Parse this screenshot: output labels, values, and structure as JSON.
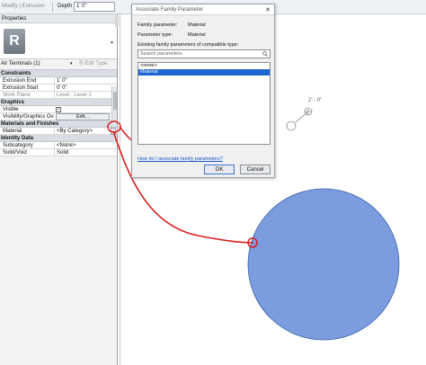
{
  "options_bar": {
    "mode_label": "Modify | Extrusion",
    "depth_label": "Depth",
    "depth_value": "1'  0\""
  },
  "properties": {
    "title": "Properties",
    "type_selector": "Air Terminals (1)",
    "edit_type_label": "Edit Type",
    "sections": {
      "constraints": "Constraints",
      "graphics": "Graphics",
      "materials": "Materials and Finishes",
      "identity": "Identity Data"
    },
    "rows": {
      "extrusion_end": {
        "label": "Extrusion End",
        "value": "1'  0\""
      },
      "extrusion_start": {
        "label": "Extrusion Start",
        "value": "0'  0\""
      },
      "work_plane": {
        "label": "Work Plane",
        "value": "Level : Level 1"
      },
      "visible": {
        "label": "Visible",
        "value": "✓"
      },
      "vis_override": {
        "label": "Visibility/Graphics Ov...",
        "value": "Edit..."
      },
      "material": {
        "label": "Material",
        "value": "<By Category>"
      },
      "subcategory": {
        "label": "Subcategory",
        "value": "<None>"
      },
      "solid_void": {
        "label": "Solid/Void",
        "value": "Solid"
      }
    }
  },
  "dialog": {
    "title": "Associate Family Parameter",
    "family_parameter_label": "Family parameter:",
    "family_parameter_value": "Material",
    "parameter_type_label": "Parameter type:",
    "parameter_type_value": "Material",
    "existing_label": "Existing family parameters of compatible type:",
    "search_placeholder": "Search parameters",
    "list_items": [
      "<none>",
      "Material"
    ],
    "selected_index": 1,
    "help_link": "How do I associate family parameters?",
    "ok_label": "OK",
    "cancel_label": "Cancel"
  },
  "canvas": {
    "dimension_text": "2' - 0\"",
    "circle_fill": "#7b9de0",
    "annotation_color": "#d81e1e",
    "selection_color": "#1e66d0"
  }
}
